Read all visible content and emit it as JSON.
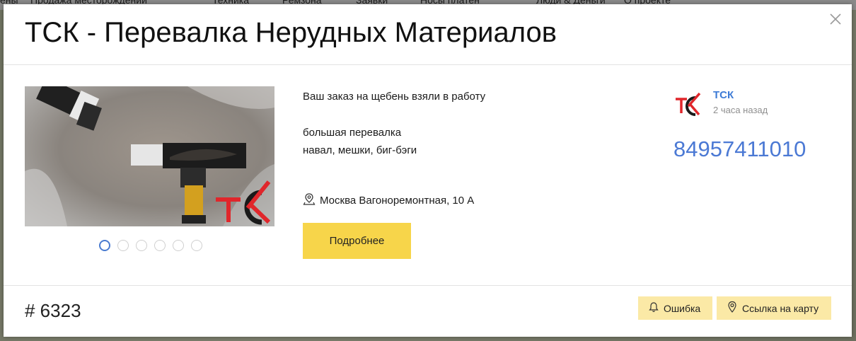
{
  "background_nav": [
    "ены",
    "Продажа месторождений",
    "Техника",
    "Ремзона",
    "Заявки",
    "Носы платен",
    "Люди & Деньги",
    "О проекте"
  ],
  "modal": {
    "title": "ТСК - Перевалка Нерудных Материалов",
    "description_line1": "Ваш заказ на щебень взяли в работу",
    "description_line2": "большая перевалка",
    "description_line3": "навал, мешки, биг-бэги",
    "address": "Москва Вагоноремонтная, 10 А",
    "more_button": "Подробнее",
    "author_name": "ТСК",
    "author_time": "2 часа назад",
    "phone": "84957411010",
    "order_id": "# 6323",
    "error_button": "Ошибка",
    "map_link_button": "Ссылка на карту",
    "carousel_dots": 6,
    "carousel_active": 0
  },
  "colors": {
    "accent_yellow": "#f7d54a",
    "light_yellow": "#fbe9a6",
    "link_blue": "#3d7bd6",
    "logo_red": "#e0262b"
  }
}
